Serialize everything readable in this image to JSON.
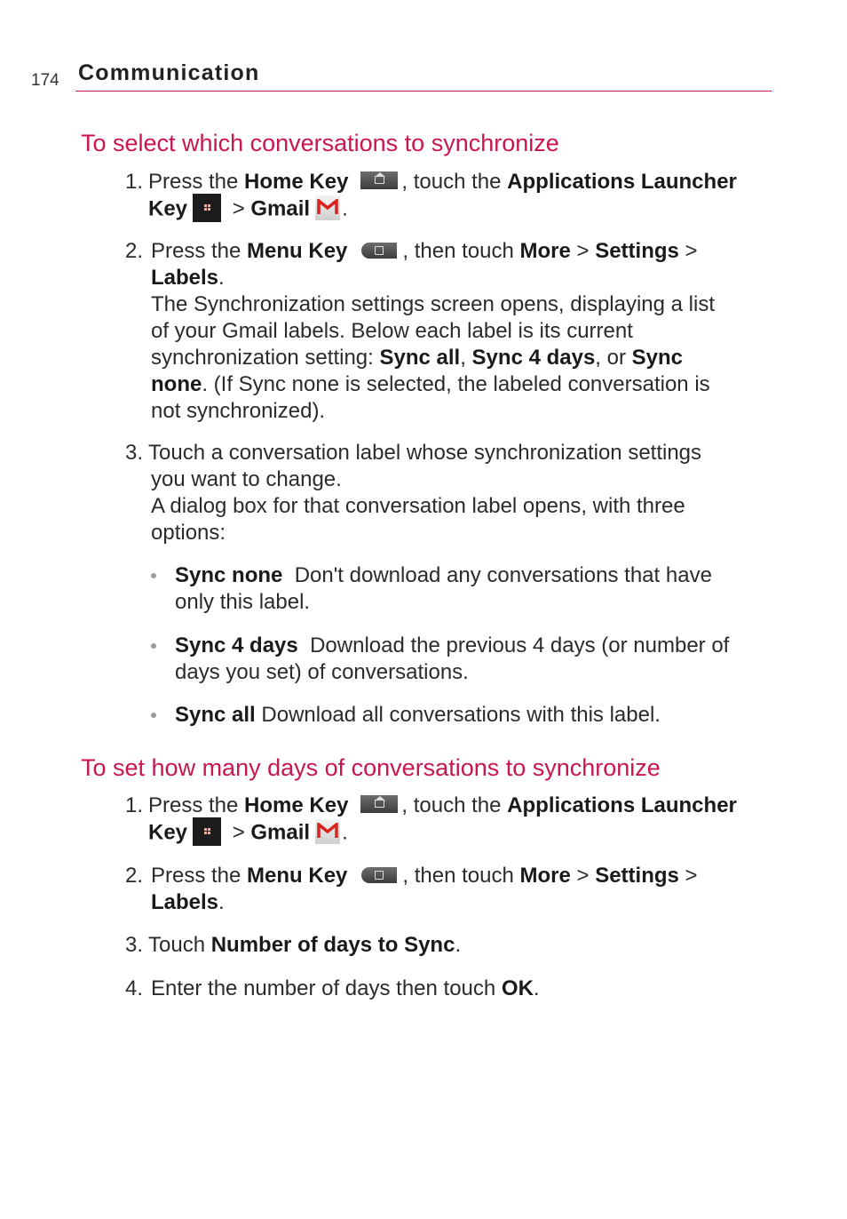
{
  "header": {
    "page_number": "174",
    "chapter": "Communication"
  },
  "accent_color": "#c8164f",
  "section1": {
    "title": "To select which conversations to synchronize",
    "step1": {
      "num": "1.",
      "t1": "Press the ",
      "home": "Home Key",
      "t2": ", touch the ",
      "apps": "Applications Launcher",
      "key": "Key",
      "t3": " > ",
      "gmail": "Gmail",
      "t4": "."
    },
    "step2": {
      "num": "2.",
      "t1": "Press the ",
      "menu": "Menu Key",
      "t2": ", then touch ",
      "more": "More",
      "sep1": " > ",
      "settings": "Settings",
      "sep2": " >",
      "labels": "Labels",
      "end": ".",
      "p1": "The Synchronization settings screen opens, displaying a list",
      "p2": "of your Gmail labels. Below each label is its current",
      "p3a": "synchronization setting: ",
      "sync_all": "Sync all",
      "c1": ", ",
      "sync_4": "Sync 4 days",
      "c2": ", or ",
      "sync": "Sync",
      "none": "none",
      "p4": ". (If Sync none is selected, the labeled conversation is",
      "p5": "not synchronized)."
    },
    "step3": {
      "num": "3.",
      "l1": "Touch a conversation label whose synchronization settings",
      "l2": "you want to change.",
      "l3": "A dialog box for that conversation label opens, with three",
      "l4": "options:"
    },
    "bullets": [
      {
        "term": "Sync none",
        "l1": "  Don't download any conversations that have",
        "l2": "only this label."
      },
      {
        "term": "Sync 4 days",
        "l1": "  Download the previous 4 days (or number of",
        "l2": "days you set) of conversations."
      },
      {
        "term": "Sync all",
        "l1": " Download all conversations with this label.",
        "l2": ""
      }
    ]
  },
  "section2": {
    "title": "To set how many days of conversations to synchronize",
    "step1": {
      "num": "1.",
      "t1": "Press the ",
      "home": "Home Key",
      "t2": ", touch the ",
      "apps": "Applications Launcher",
      "key": "Key",
      "t3": " > ",
      "gmail": "Gmail",
      "t4": "."
    },
    "step2": {
      "num": "2.",
      "t1": "Press the ",
      "menu": "Menu Key",
      "t2": ", then touch ",
      "more": "More",
      "sep1": " > ",
      "settings": "Settings",
      "sep2": " >",
      "labels": "Labels",
      "end": "."
    },
    "step3": {
      "num": "3.",
      "t1": "Touch ",
      "target": "Number of days to Sync",
      "end": "."
    },
    "step4": {
      "num": "4.",
      "t1": "Enter the number of days then touch ",
      "ok": "OK",
      "end": "."
    }
  }
}
